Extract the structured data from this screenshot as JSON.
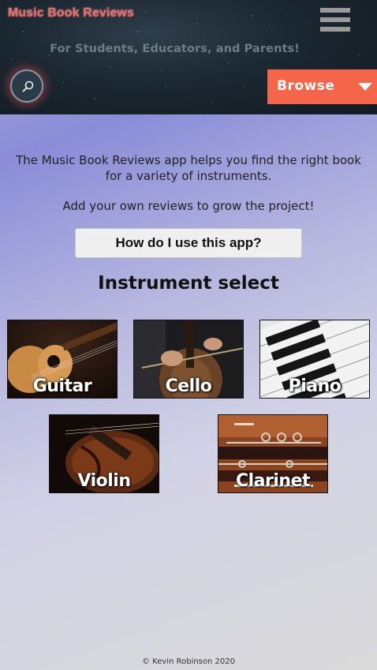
{
  "header": {
    "title": "Music Book Reviews",
    "subtitle": "For Students, Educators, and Parents!",
    "browse_label": "Browse",
    "menu_icon": "hamburger-menu-icon",
    "search_icon": "search-icon"
  },
  "main": {
    "intro_text": "The Music Book Reviews app helps you find the right book for a variety of instruments.",
    "cta_text": "Add your own reviews to grow the project!",
    "howto_label": "How do I use this app?",
    "section_title": "Instrument select",
    "instruments": [
      {
        "label": "Guitar"
      },
      {
        "label": "Cello"
      },
      {
        "label": "Piano"
      },
      {
        "label": "Violin"
      },
      {
        "label": "Clarinet"
      }
    ]
  },
  "footer": {
    "copyright": "© Kevin Robinson 2020"
  },
  "colors": {
    "accent": "#f5654a",
    "header_bg": "#1b2731",
    "title_color": "#e26a6a"
  }
}
